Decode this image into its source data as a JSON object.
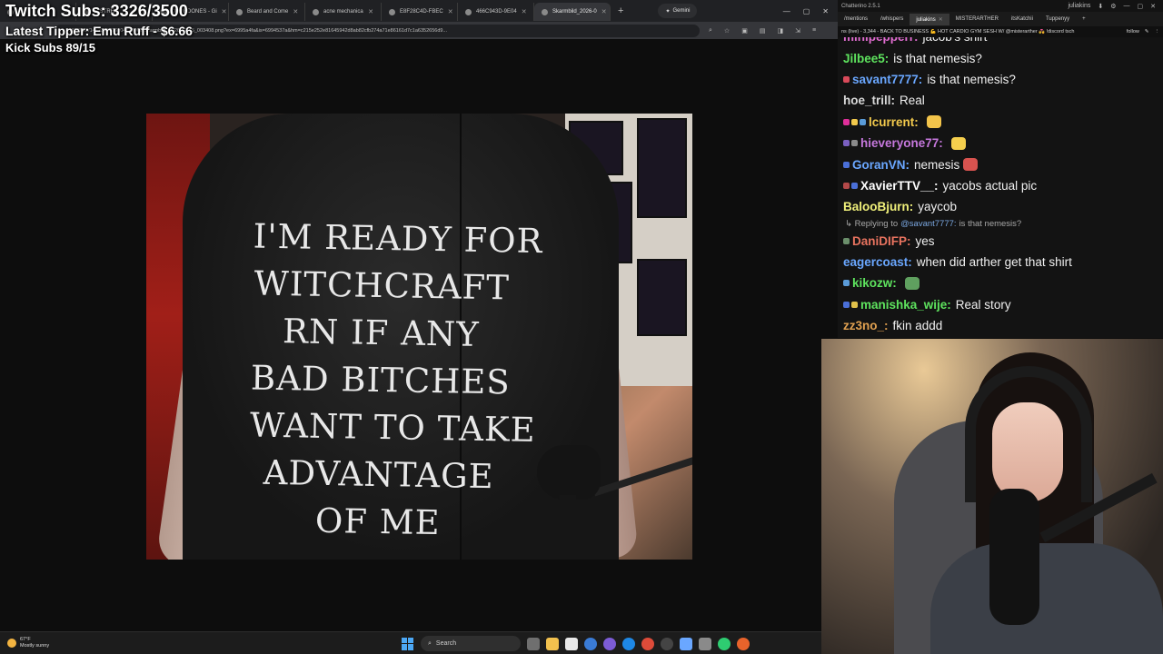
{
  "overlay": {
    "subs": "Twitch Subs: 3326/3500",
    "tipper": "Latest Tipper: Emu Ruff - $6.66",
    "kick": "Kick Subs 89/15"
  },
  "browser": {
    "tabs": [
      {
        "label": "...",
        "active": false
      },
      {
        "label": "S STREA",
        "active": false
      },
      {
        "label": "COMEDONES - Gi",
        "active": false
      },
      {
        "label": "Beard and Come",
        "active": false
      },
      {
        "label": "acne mechanica",
        "active": false
      },
      {
        "label": "E8F28C4D-FBEC",
        "active": false
      },
      {
        "label": "466C943D-9E04",
        "active": false
      },
      {
        "label": "Skarmbild_2026-0",
        "active": true
      }
    ],
    "new_tab": "+",
    "gemini_label": "Gemini",
    "window_controls": [
      "—",
      "▢",
      "✕"
    ],
    "url": "...71832012/1472376776104738969/Skarmbild_2026-02-15_003408.png?ex=6995a4fa&is=6994537a&hm=c215e252e81645942d8ab82cfb274a71e86161d7c1a6352656d9...",
    "tool_icons": [
      "⌕",
      "☆",
      "▣",
      "▤",
      "◨",
      "⇲",
      "≡"
    ]
  },
  "shirt_text": [
    "I'M READY FOR",
    "WITCHCRAFT",
    "RN IF ANY",
    "BAD BITCHES",
    "WANT TO TAKE",
    "ADVANTAGE",
    "OF ME"
  ],
  "taskbar": {
    "temp": "67°F",
    "condition": "Mostly sunny",
    "search_label": "Search"
  },
  "chat": {
    "title": "Chatterino 2.5.1",
    "account": "juliakins",
    "tabs": [
      {
        "label": "/mentions",
        "active": false
      },
      {
        "label": "/whispers",
        "active": false
      },
      {
        "label": "juliakins",
        "active": true
      },
      {
        "label": "MISTERARTHER",
        "active": false
      },
      {
        "label": "itsKatchii",
        "active": false
      },
      {
        "label": "Tuppenyy",
        "active": false
      }
    ],
    "status_line": "ns (live) - 3,344 - BACK TO BUSINESS 💪 HOT CARDIO GYM SESH W/ @misterarther 💑 !discord tsch",
    "follow_label": "follow",
    "messages": [
      {
        "user": "minipepperr:",
        "color": "#e06cd0",
        "text": "jacob's shirt",
        "badges": [],
        "emote": null
      },
      {
        "user": "Jilbee5:",
        "color": "#5ee35e",
        "text": "is that nemesis?",
        "badges": [],
        "emote": null
      },
      {
        "user": "savant7777:",
        "color": "#6aa7ff",
        "text": "is that nemesis?",
        "badges": [
          "#d94a5a"
        ],
        "emote": null
      },
      {
        "user": "hoe_trill:",
        "color": "#d8d8d8",
        "text": "Real",
        "badges": [],
        "emote": null
      },
      {
        "user": "lcurrent:",
        "color": "#f2c94c",
        "text": "",
        "badges": [
          "#e02f9a",
          "#f2c94c",
          "#5a9bd8"
        ],
        "emote": "#f3c44a"
      },
      {
        "user": "hieveryone77:",
        "color": "#c678dd",
        "text": "",
        "badges": [
          "#7a5fc0",
          "#8a8a8a"
        ],
        "emote": "#f5cf4d"
      },
      {
        "user": "GoranVN:",
        "color": "#6aa7ff",
        "text": "nemesis",
        "badges": [
          "#4a6fd8"
        ],
        "emote": "#d9534f"
      },
      {
        "user": "XavierTTV__:",
        "color": "#ffffff",
        "text": "yacobs actual pic",
        "badges": [
          "#b34949",
          "#4a6fd8"
        ],
        "emote": null
      },
      {
        "user": "BalooBjurn:",
        "color": "#f0f07a",
        "text": "yaycob",
        "badges": [],
        "emote": null
      },
      {
        "reply": true,
        "prefix": "Replying to",
        "mention": "@savant7777:",
        "text": "is that nemesis?"
      },
      {
        "user": "DaniDIFP:",
        "color": "#e8735f",
        "text": "yes",
        "badges": [
          "#6b8f6b"
        ],
        "emote": null
      },
      {
        "user": "eagercoast:",
        "color": "#6aa7ff",
        "text": "when did arther get that shirt",
        "badges": [],
        "emote": null
      },
      {
        "user": "kikozw:",
        "color": "#5ee35e",
        "text": "",
        "badges": [
          "#5a9bd8"
        ],
        "emote": "#5fa05f"
      },
      {
        "user": "manishka_wije:",
        "color": "#5ee35e",
        "text": "Real story",
        "badges": [
          "#4a6fd8",
          "#e0c04a"
        ],
        "emote": null
      },
      {
        "user": "zz3no_:",
        "color": "#e0a050",
        "text": "fkin addd",
        "badges": [],
        "emote": null
      }
    ]
  }
}
